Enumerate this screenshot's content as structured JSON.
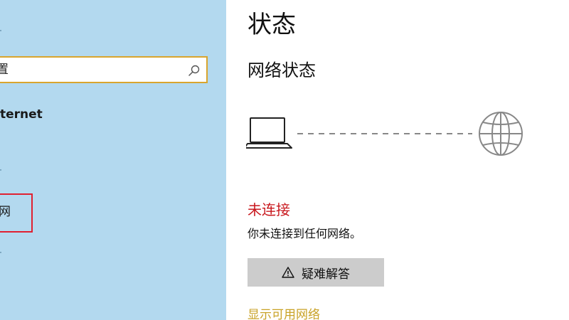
{
  "sidebar": {
    "search_text": "置",
    "nav_item_internet": "ternet",
    "highlighted_item": "网"
  },
  "main": {
    "page_title": "状态",
    "section_title": "网络状态",
    "status": "未连接",
    "status_description": "你未连接到任何网络。",
    "troubleshoot_label": "疑难解答",
    "show_networks_link": "显示可用网络"
  },
  "icons": {
    "search": "search-icon",
    "laptop": "laptop-icon",
    "globe": "globe-icon",
    "warning": "warning-icon"
  },
  "colors": {
    "sidebar_bg": "#b3d9ef",
    "search_border": "#d9a52e",
    "highlight_border": "#e02030",
    "status_error": "#c8171d",
    "button_bg": "#cccccc",
    "link": "#c9a227"
  }
}
